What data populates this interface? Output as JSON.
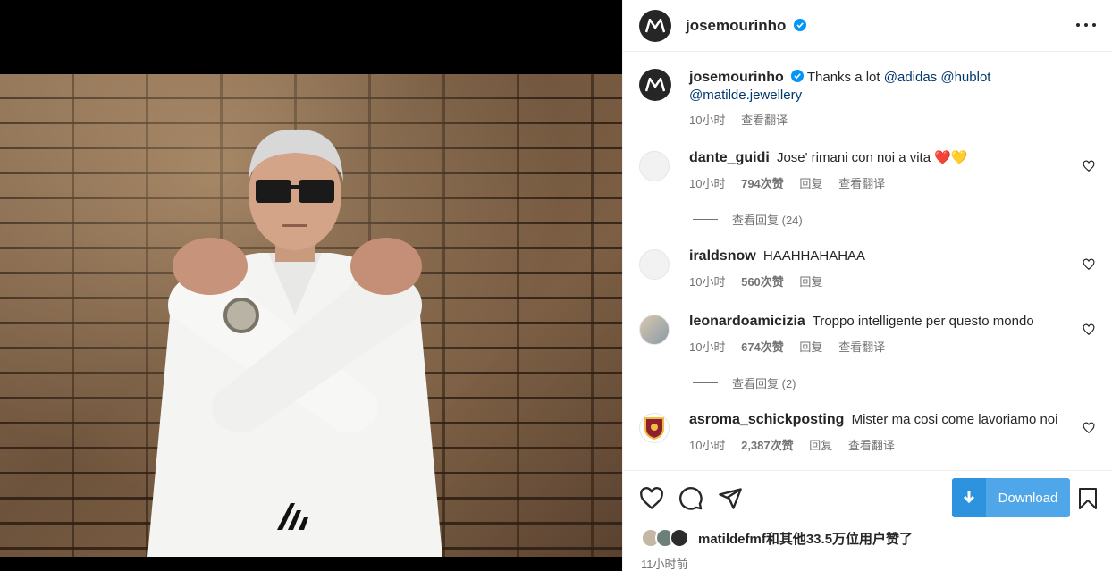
{
  "post": {
    "username": "josemourinho",
    "avatar_letter": "M"
  },
  "caption": {
    "username": "josemourinho",
    "text": "Thanks a lot",
    "mentions": [
      "@adidas",
      "@hublot",
      "@matilde.jewellery"
    ],
    "time": "10小时",
    "translate": "查看翻译"
  },
  "comments": [
    {
      "username": "dante_guidi",
      "text": "Jose' rimani con noi a vita",
      "time": "10小时",
      "likes": "794次赞",
      "reply": "回复",
      "translate": "查看翻译",
      "view_replies": "查看回复 (24)",
      "emoji": "❤️💛"
    },
    {
      "username": "iraldsnow",
      "text": "HAAHHAHAHAA",
      "time": "10小时",
      "likes": "560次赞",
      "reply": "回复"
    },
    {
      "username": "leonardoamicizia",
      "text": "Troppo intelligente per questo mondo",
      "time": "10小时",
      "likes": "674次赞",
      "reply": "回复",
      "translate": "查看翻译",
      "view_replies": "查看回复 (2)"
    },
    {
      "username": "asroma_schickposting",
      "text": "Mister ma cosi come lavoriamo noi",
      "time": "10小时",
      "likes": "2,387次赞",
      "reply": "回复",
      "translate": "查看翻译"
    }
  ],
  "actions": {
    "download_label": "Download",
    "likes_text": "matildefmf和其他33.5万位用户赞了",
    "timestamp": "11小时前"
  },
  "colors": {
    "link": "#00376b",
    "download_bg": "#4fa6e8",
    "verified": "#0095f6"
  },
  "icons": [
    "more-icon",
    "verified-icon",
    "heart-icon",
    "comment-icon",
    "share-icon",
    "download-icon",
    "bookmark-icon"
  ]
}
